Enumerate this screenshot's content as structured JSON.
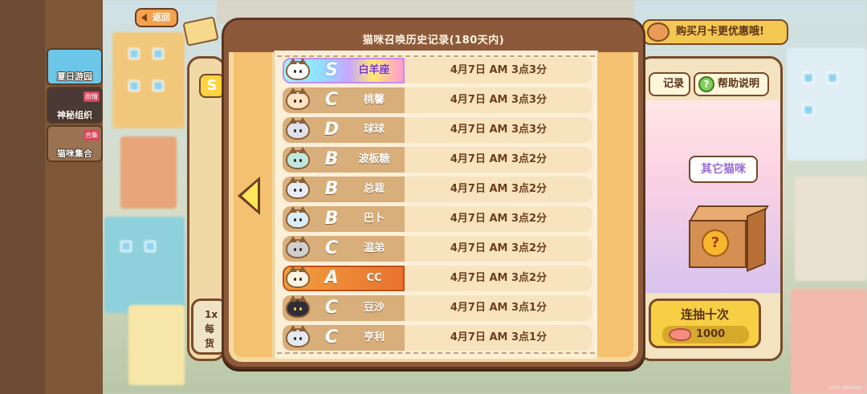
{
  "nav": {
    "back_label": "返回",
    "side_tabs": [
      {
        "label": "夏日游园",
        "color": "#6bc6e8"
      },
      {
        "label": "神秘组织",
        "color": "#4a3a35",
        "badge": "剧情"
      },
      {
        "label": "猫咪集合",
        "color": "#9a7352",
        "badge": "合集"
      }
    ]
  },
  "background": {
    "month_card_label": "购买月卡更优惠哦!",
    "records_label": "记录",
    "help_label": "帮助说明",
    "help_symbol": "?",
    "other_cats_label": "其它猫咪",
    "box_symbol": "?",
    "ten_draw_label": "连抽十次",
    "ten_draw_cost": "1000",
    "one_draw_label": "1x",
    "one_draw_sub1": "每",
    "one_draw_sub2": "货",
    "s_badge": "S"
  },
  "modal": {
    "title": "猫咪召唤历史记录(180天内)",
    "prev_page_icon": "chevron-left-icon",
    "rows": [
      {
        "grade": "S",
        "name": "白羊座",
        "time": "4月7日 AM 3点3分",
        "rarity": "s",
        "cat_color": "#ffffff"
      },
      {
        "grade": "C",
        "name": "桃馨",
        "time": "4月7日 AM 3点3分",
        "rarity": "c",
        "cat_color": "#ffe2c4"
      },
      {
        "grade": "D",
        "name": "球球",
        "time": "4月7日 AM 3点3分",
        "rarity": "d",
        "cat_color": "#dfe2ee"
      },
      {
        "grade": "B",
        "name": "波板糖",
        "time": "4月7日 AM 3点2分",
        "rarity": "b",
        "cat_color": "#bfe8df"
      },
      {
        "grade": "B",
        "name": "总裁",
        "time": "4月7日 AM 3点2分",
        "rarity": "b",
        "cat_color": "#e6ecf6"
      },
      {
        "grade": "B",
        "name": "巴卜",
        "time": "4月7日 AM 3点2分",
        "rarity": "b",
        "cat_color": "#d9eefc"
      },
      {
        "grade": "C",
        "name": "温弟",
        "time": "4月7日 AM 3点2分",
        "rarity": "c",
        "cat_color": "#cfcfcf"
      },
      {
        "grade": "A",
        "name": "CC",
        "time": "4月7日 AM 3点2分",
        "rarity": "a",
        "cat_color": "#fff3e2"
      },
      {
        "grade": "C",
        "name": "豆沙",
        "time": "4月7日 AM 3点1分",
        "rarity": "c",
        "cat_color": "#2f2d38"
      },
      {
        "grade": "C",
        "name": "亨利",
        "time": "4月7日 AM 3点1分",
        "rarity": "c",
        "cat_color": "#e3e9f2"
      }
    ]
  },
  "watermark": "trial version"
}
